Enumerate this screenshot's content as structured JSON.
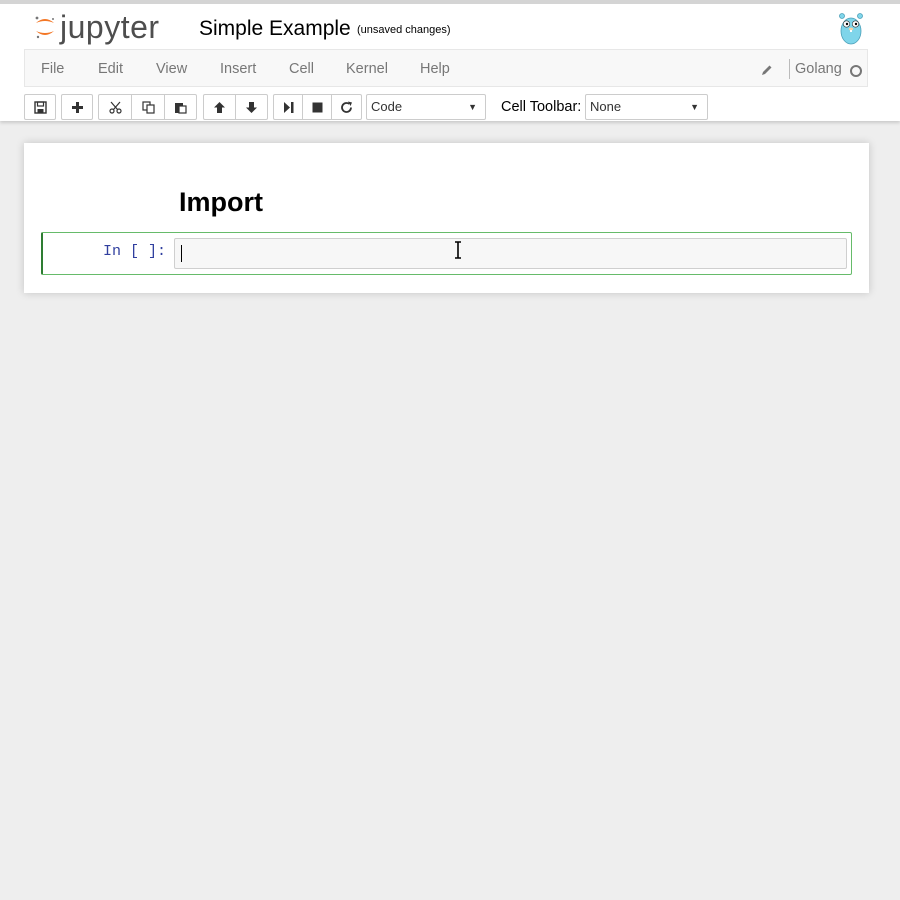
{
  "header": {
    "logo_text": "jupyter",
    "notebook_title": "Simple Example",
    "save_status": "(unsaved changes)",
    "kernel_logo_icon": "gopher-icon"
  },
  "menu": {
    "items": [
      "File",
      "Edit",
      "View",
      "Insert",
      "Cell",
      "Kernel",
      "Help"
    ],
    "edit_mode_icon": "pencil-icon",
    "kernel_name": "Golang",
    "kernel_status_icon": "kernel-idle-circle-icon"
  },
  "toolbar": {
    "buttons": [
      "save-icon",
      "plus-icon",
      "cut-icon",
      "copy-icon",
      "paste-icon",
      "arrow-up-icon",
      "arrow-down-icon",
      "run-step-icon",
      "stop-icon",
      "restart-icon"
    ],
    "cell_type": "Code",
    "cell_toolbar_label": "Cell Toolbar:",
    "cell_toolbar_value": "None"
  },
  "notebook": {
    "markdown_heading": "Import",
    "code_prompt": "In [ ]:",
    "code_content": ""
  },
  "colors": {
    "accent_orange": "#f37726",
    "selected_cell_border": "#2e7d32",
    "prompt_blue": "#303f9f",
    "page_background": "#eeeeee"
  }
}
